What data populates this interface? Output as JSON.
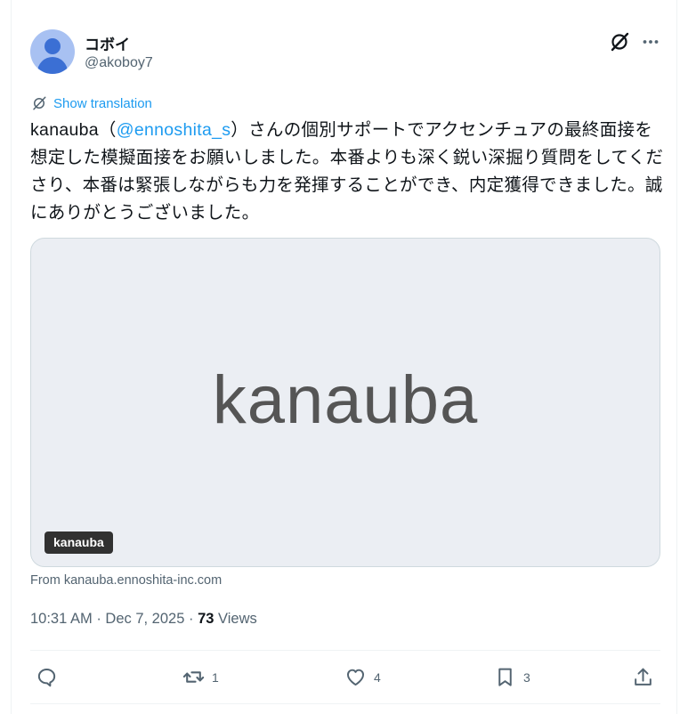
{
  "author": {
    "display_name": "コボイ",
    "handle": "@akoboy7"
  },
  "translation": {
    "label": "Show translation"
  },
  "tweet": {
    "text_before": "kanauba（",
    "mention": "@ennoshita_s",
    "text_after": "）さんの個別サポートでアクセンチュアの最終面接を想定した模擬面接をお願いしました。本番よりも深く鋭い深掘り質問をしてくださり、本番は緊張しながらも力を発揮することができ、内定獲得できました。誠にありがとうございました。"
  },
  "card": {
    "logo_text": "kanauba",
    "badge_label": "kanauba",
    "from_text": "From kanauba.ennoshita-inc.com"
  },
  "meta": {
    "time": "10:31 AM",
    "date": "Dec 7, 2025",
    "views_count": "73",
    "views_label": "Views",
    "separator": "·"
  },
  "actions": {
    "reply_count": "",
    "retweet_count": "1",
    "like_count": "4",
    "bookmark_count": "3"
  },
  "icons": {
    "avatar": "default-avatar-icon",
    "grok": "grok-icon",
    "more": "more-dots-icon",
    "translate": "translate-globe-icon",
    "reply": "reply-icon",
    "retweet": "retweet-icon",
    "like": "heart-icon",
    "bookmark": "bookmark-icon",
    "share": "share-icon"
  },
  "colors": {
    "accent": "#1d9bf0",
    "text": "#0f1419",
    "muted": "#536471",
    "card_bg": "#ebeef3",
    "avatar_bg": "#a8c1f2"
  }
}
